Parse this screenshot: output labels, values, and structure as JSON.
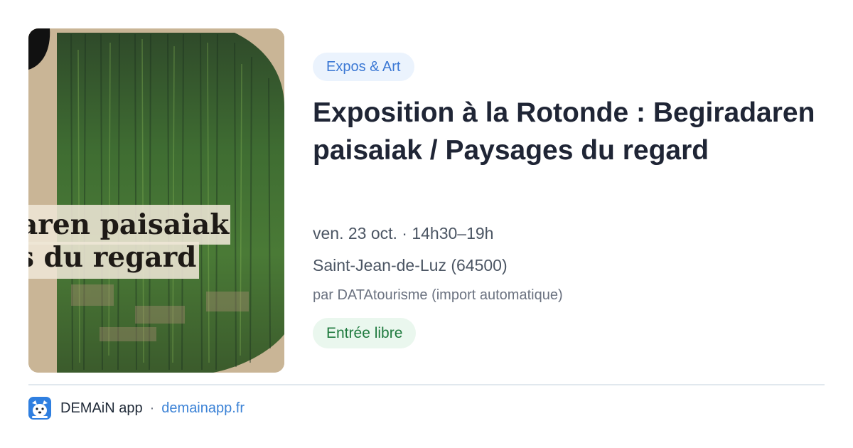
{
  "card": {
    "image": "poster-painting",
    "poster_line1": "aren paisaiak",
    "poster_line2": "s du regard"
  },
  "event": {
    "category": "Expos & Art",
    "title": "Exposition à la Rotonde : Begiradaren paisaiak / Paysages du regard",
    "datetime": "ven. 23 oct. · 14h30–19h",
    "location": "Saint-Jean-de-Luz (64500)",
    "source": "par DATAtourisme (import automatique)",
    "price_badge": "Entrée libre"
  },
  "footer": {
    "app_icon": "dog-mascot-icon",
    "app_name": "DEMAiN app",
    "separator": "·",
    "app_url": "demainapp.fr"
  },
  "colors": {
    "accent_blue": "#3b78d4",
    "category_bg": "#ebf3fd",
    "badge_green": "#1f7a3e",
    "badge_bg": "#eaf7ee",
    "title": "#1f2535"
  }
}
